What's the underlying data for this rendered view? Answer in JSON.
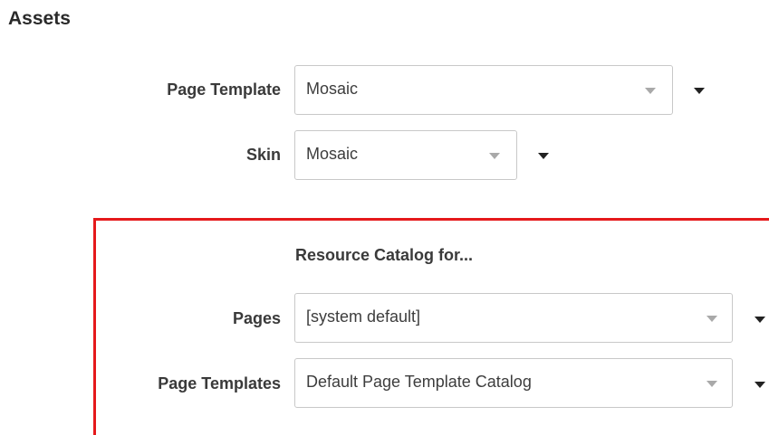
{
  "section": {
    "title": "Assets"
  },
  "fields": {
    "page_template": {
      "label": "Page Template",
      "value": "Mosaic"
    },
    "skin": {
      "label": "Skin",
      "value": "Mosaic"
    }
  },
  "resource_catalog": {
    "heading": "Resource Catalog for...",
    "pages": {
      "label": "Pages",
      "value": "[system default]"
    },
    "page_templates": {
      "label": "Page Templates",
      "value": "Default Page Template Catalog"
    }
  },
  "colors": {
    "highlight_border": "#e5191b",
    "field_border": "#c8c8c8",
    "caret_gray": "#a9a9a9",
    "caret_dark": "#222222"
  },
  "icons": {
    "select_caret": "caret-down-icon",
    "menu_caret": "chevron-down-icon"
  }
}
